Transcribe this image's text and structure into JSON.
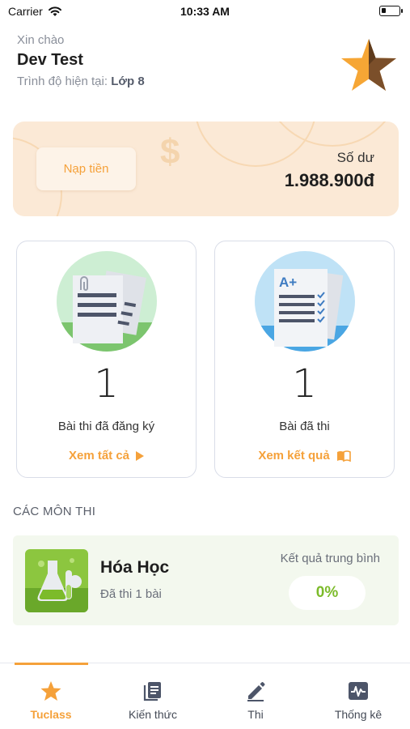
{
  "status_bar": {
    "carrier": "Carrier",
    "time": "10:33 AM",
    "battery_level": 0.25
  },
  "header": {
    "greeting": "Xin chào",
    "username": "Dev Test",
    "level_prefix": "Trình độ hiện tại: ",
    "level_value": "Lớp 8",
    "logo_icon": "star-icon"
  },
  "balance": {
    "topup_label": "Nạp tiền",
    "balance_label": "Số dư",
    "balance_value": "1.988.900đ",
    "background_color": "#fbe9d6"
  },
  "stats": [
    {
      "number": "1",
      "label": "Bài thi đã đăng ký",
      "link_label": "Xem tất cả",
      "illustration": "registered-exams-icon",
      "link_icon": "play-icon"
    },
    {
      "number": "1",
      "label": "Bài đã thi",
      "link_label": "Xem kết quả",
      "illustration": "exam-result-icon",
      "link_icon": "book-icon"
    }
  ],
  "subjects_section": {
    "title": "CÁC MÔN THI",
    "items": [
      {
        "name": "Hóa Học",
        "count_text": "Đã thi 1 bài",
        "avg_label": "Kết quả trung bình",
        "avg_value": "0%",
        "thumbnail": "chemistry-icon"
      }
    ]
  },
  "tab_bar": {
    "active_index": 0,
    "accent_color": "#f5a13a",
    "tabs": [
      {
        "label": "Tuclass",
        "icon": "star-icon"
      },
      {
        "label": "Kiến thức",
        "icon": "books-icon"
      },
      {
        "label": "Thi",
        "icon": "pencil-icon"
      },
      {
        "label": "Thống kê",
        "icon": "chart-icon"
      }
    ]
  }
}
